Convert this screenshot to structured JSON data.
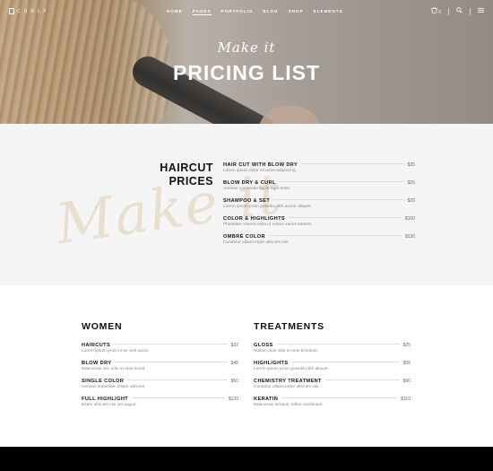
{
  "nav": {
    "logo": "CURLY",
    "menu": [
      {
        "label": "Home",
        "active": false
      },
      {
        "label": "Pages",
        "active": true
      },
      {
        "label": "Portfolio",
        "active": false
      },
      {
        "label": "Blog",
        "active": false
      },
      {
        "label": "Shop",
        "active": false
      },
      {
        "label": "Elements",
        "active": false
      }
    ],
    "cart_count": "0",
    "icons": [
      "cart-icon",
      "search-icon",
      "menu-icon"
    ]
  },
  "hero": {
    "script": "Make it",
    "title": "PRICING LIST"
  },
  "haircut": {
    "heading_line1": "HAIRCUT",
    "heading_line2": "PRICES",
    "watermark": "Make it",
    "items": [
      {
        "name": "Hair cut with blow dry",
        "price": "$35",
        "desc": "Lorem ipsum dolor sit amet adipiscing."
      },
      {
        "name": "Blow dry & curl",
        "price": "$25",
        "desc": "Aenean commodo ligula eget dolor."
      },
      {
        "name": "Shampoo & set",
        "price": "$25",
        "desc": "Lorem ipsum proin gravida nibh auctor aliquet."
      },
      {
        "name": "Color & highlights",
        "price": "$100",
        "desc": "Phasellus viverra nulla ut metus varius laoreet."
      },
      {
        "name": "Ombré color",
        "price": "$130",
        "desc": "Curabitur ullamcorper ultricies nisi."
      }
    ]
  },
  "women": {
    "title": "WOMEN",
    "items": [
      {
        "name": "Haircuts",
        "price": "$32",
        "desc": "Lorem ipsum proin ni se velit aucto."
      },
      {
        "name": "Blow dry",
        "price": "$45",
        "desc": "Maecenas nec odio et ante tincid."
      },
      {
        "name": "Single color",
        "price": "$50",
        "desc": "Aenean imperdiet. Etiam ultricies."
      },
      {
        "name": "Full highlight",
        "price": "$120",
        "desc": "Etiam ultricies nisi vel augue."
      }
    ]
  },
  "treatments": {
    "title": "TREATMENTS",
    "items": [
      {
        "name": "Gloss",
        "price": "$25",
        "desc": "Nullam quis odio et ante tincidunt."
      },
      {
        "name": "Highlights",
        "price": "$55",
        "desc": "Lorem ipsum proin gravida nibh aliquet."
      },
      {
        "name": "Chemistry treatment",
        "price": "$90",
        "desc": "Curabitur ullamcorper ultricies nisi."
      },
      {
        "name": "Keratin",
        "price": "$110",
        "desc": "Maecenas tempus, tellus condiment."
      }
    ]
  }
}
